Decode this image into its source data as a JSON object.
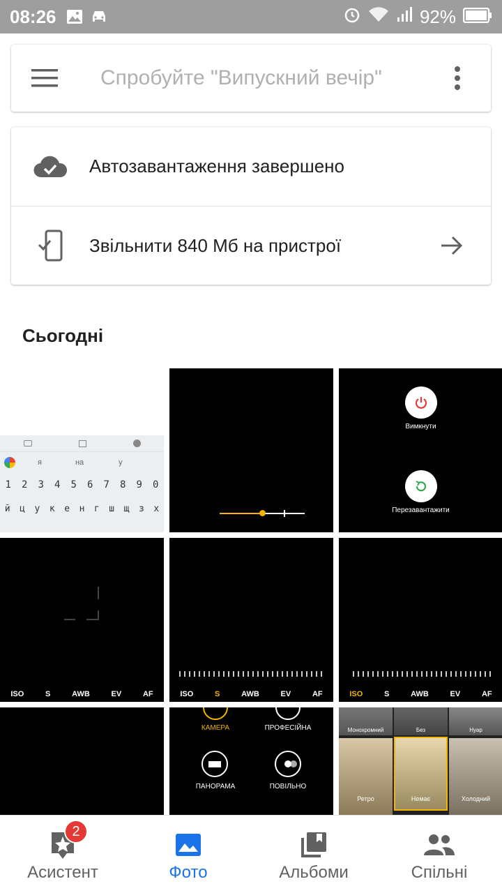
{
  "status_bar": {
    "time": "08:26",
    "battery": "92%"
  },
  "search": {
    "placeholder": "Спробуйте \"Випускний вечір\""
  },
  "info": {
    "backup_text": "Автозавантаження завершено",
    "free_space_text": "Звільнити 840 Мб на пристрої"
  },
  "section": {
    "title": "Сьогодні"
  },
  "thumbs": {
    "keyboard": {
      "suggestions": [
        "я",
        "на",
        "у"
      ],
      "numbers": [
        "1",
        "2",
        "3",
        "4",
        "5",
        "6",
        "7",
        "8",
        "9",
        "0"
      ],
      "letters": [
        "й",
        "ц",
        "у",
        "к",
        "е",
        "н",
        "г",
        "ш",
        "щ",
        "з",
        "х"
      ]
    },
    "power": {
      "off_label": "Вимкнути",
      "restart_label": "Перезавантажити"
    },
    "camera_row": [
      "ISO",
      "S",
      "AWB",
      "EV",
      "AF"
    ],
    "modes": {
      "camera": "КАМЕРА",
      "pro": "ПРОФЕСІЙНА",
      "panorama": "ПАНОРАМА",
      "slow": "ПОВІЛЬНО"
    },
    "filters": {
      "top": [
        "Монохромний",
        "Без",
        "Нуар"
      ],
      "bottom": [
        "Ретро",
        "Немає",
        "Холодний"
      ]
    }
  },
  "bottom_nav": [
    {
      "label": "Асистент",
      "badge": "2"
    },
    {
      "label": "Фото"
    },
    {
      "label": "Альбоми"
    },
    {
      "label": "Спільні"
    }
  ]
}
